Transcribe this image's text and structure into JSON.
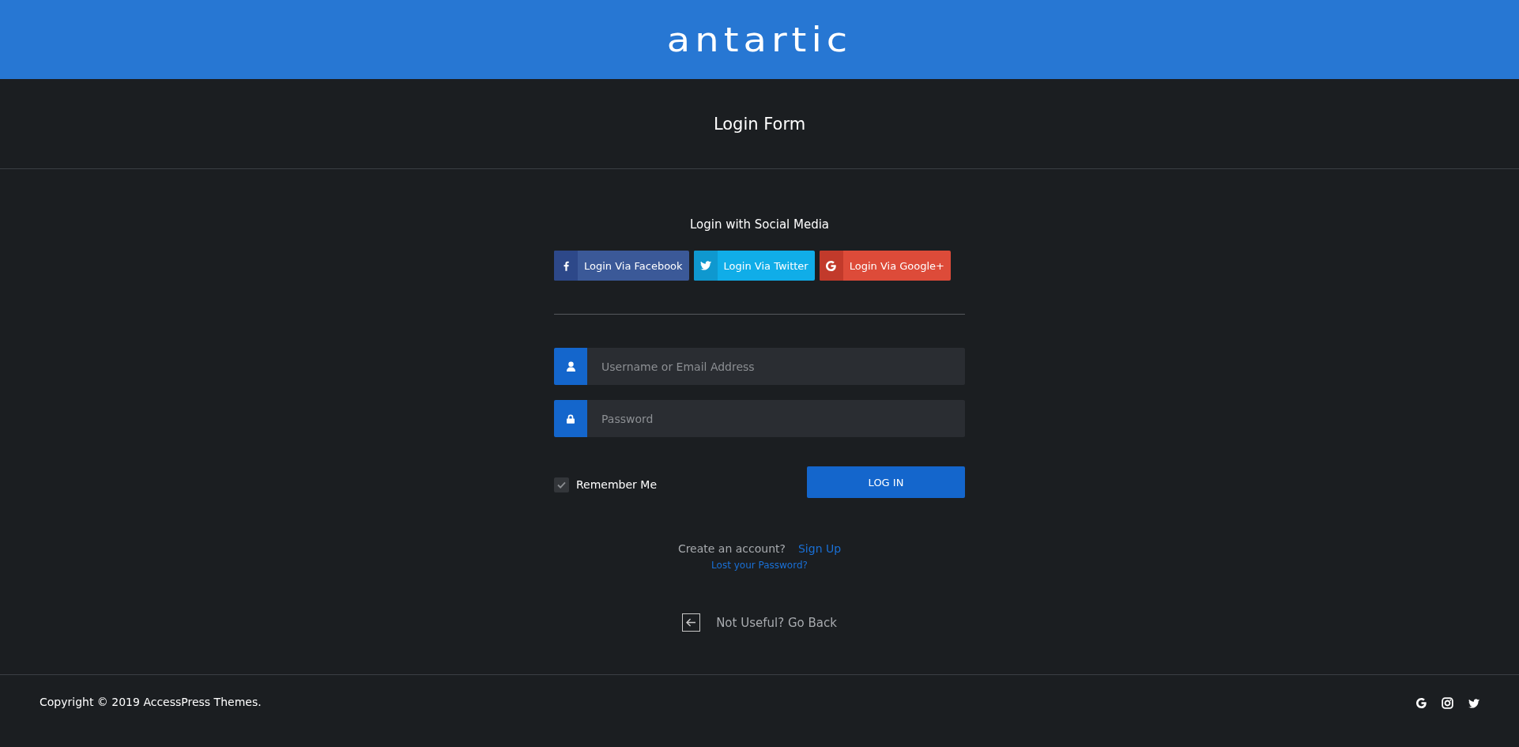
{
  "header": {
    "logo": "antartic"
  },
  "page_title": "Login Form",
  "social": {
    "heading": "Login with Social Media",
    "buttons": [
      {
        "kind": "facebook",
        "label": "Login Via Facebook"
      },
      {
        "kind": "twitter",
        "label": "Login Via Twitter"
      },
      {
        "kind": "google",
        "label": "Login Via Google+"
      }
    ]
  },
  "fields": [
    {
      "kind": "user",
      "placeholder": "Username or Email Address"
    },
    {
      "kind": "lock",
      "placeholder": "Password"
    }
  ],
  "remember": {
    "label": "Remember Me",
    "checked": true
  },
  "login_button": "LOG IN",
  "signup": {
    "prompt": "Create an account?",
    "link": "Sign Up"
  },
  "lost_password": "Lost your Password?",
  "go_back": "Not Useful? Go Back",
  "footer": {
    "copyright": "Copyright © 2019 AccessPress Themes.",
    "social_icons": [
      {
        "kind": "google"
      },
      {
        "kind": "instagram"
      },
      {
        "kind": "twitter"
      }
    ]
  }
}
